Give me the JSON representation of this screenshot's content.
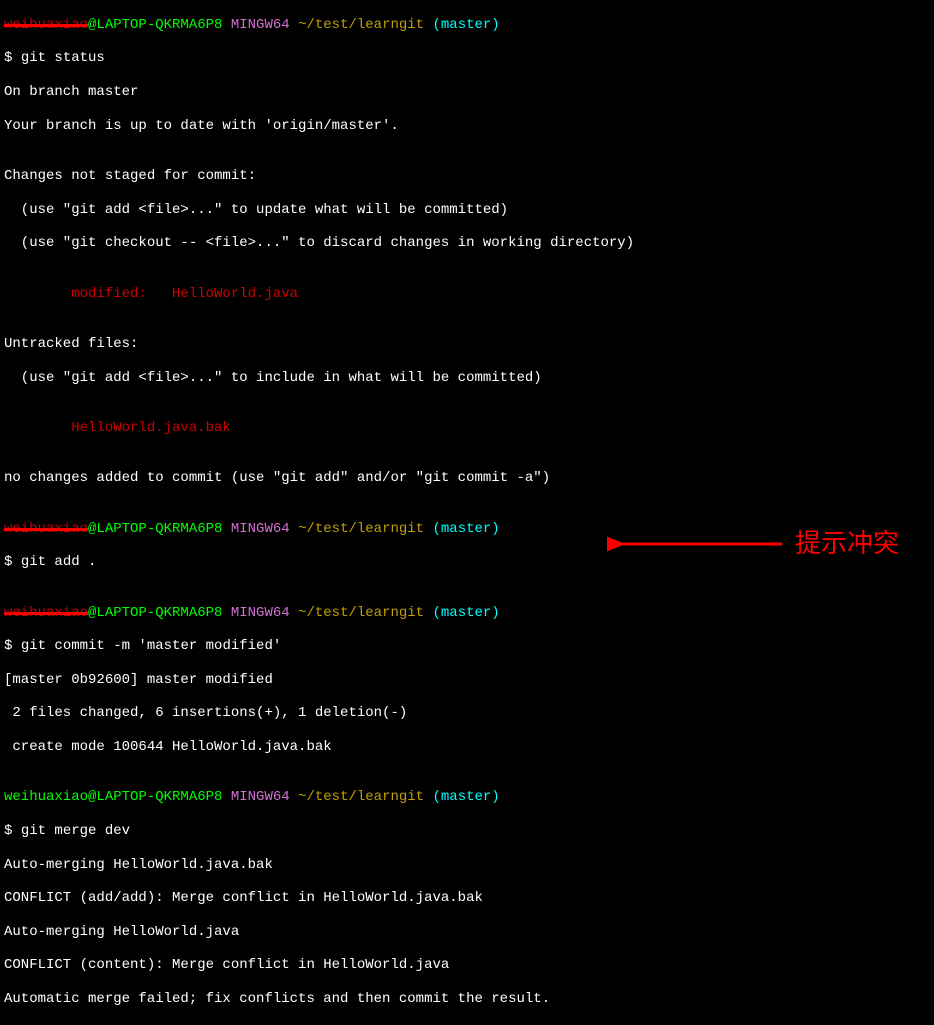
{
  "p1": {
    "user_struck": "weihuaxiao",
    "at_host": "@LAPTOP-QKRMA6P8",
    "mingw": "MINGW64",
    "path": "~/test/learngit",
    "branch": "(master)",
    "dollar": "$ ",
    "cmd": "git status",
    "out1": "On branch master",
    "out2": "Your branch is up to date with 'origin/master'.",
    "out3": "",
    "out4": "Changes not staged for commit:",
    "out5": "  (use \"git add <file>...\" to update what will be committed)",
    "out6": "  (use \"git checkout -- <file>...\" to discard changes in working directory)",
    "out7": "",
    "red1": "        modified:   HelloWorld.java",
    "out8": "",
    "out9": "Untracked files:",
    "out10": "  (use \"git add <file>...\" to include in what will be committed)",
    "out11": "",
    "red2": "        HelloWorld.java.bak",
    "out12": "",
    "out13": "no changes added to commit (use \"git add\" and/or \"git commit -a\")",
    "out14": ""
  },
  "p2": {
    "user_struck": "weihuaxiao",
    "at_host": "@LAPTOP-QKRMA6P8",
    "mingw": "MINGW64",
    "path": "~/test/learngit",
    "branch": "(master)",
    "dollar": "$ ",
    "cmd": "git add .",
    "out1": ""
  },
  "p3": {
    "user_struck": "weihuaxiao",
    "at_host": "@LAPTOP-QKRMA6P8",
    "mingw": "MINGW64",
    "path": "~/test/learngit",
    "branch": "(master)",
    "dollar": "$ ",
    "cmd": "git commit -m 'master modified'",
    "out1": "[master 0b92600] master modified",
    "out2": " 2 files changed, 6 insertions(+), 1 deletion(-)",
    "out3": " create mode 100644 HelloWorld.java.bak",
    "out4": ""
  },
  "p4": {
    "user": "weihuaxiao",
    "at_host": "@LAPTOP-QKRMA6P8",
    "mingw": "MINGW64",
    "path": "~/test/learngit",
    "branch": "(master)",
    "dollar": "$ ",
    "cmd": "git merge dev",
    "out1": "Auto-merging HelloWorld.java.bak",
    "out2": "CONFLICT (add/add): Merge conflict in HelloWorld.java.bak",
    "out3": "Auto-merging HelloWorld.java",
    "out4": "CONFLICT (content): Merge conflict in HelloWorld.java",
    "out5": "Automatic merge failed; fix conflicts and then commit the result."
  },
  "annotation": {
    "text": "提示冲突"
  }
}
